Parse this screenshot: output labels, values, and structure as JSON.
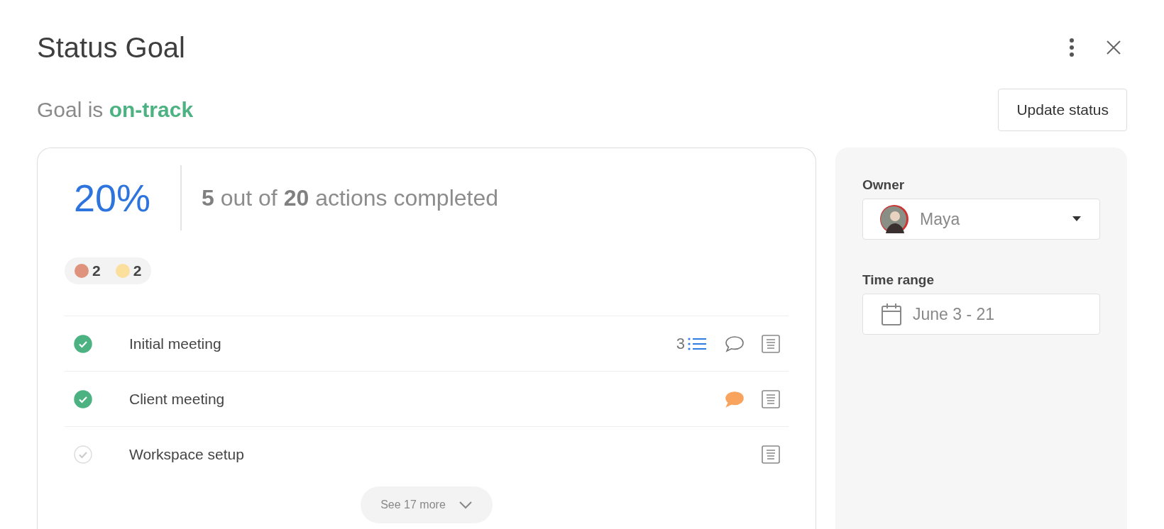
{
  "dialog": {
    "title": "Status Goal"
  },
  "status": {
    "prefix": "Goal is",
    "value": "on-track",
    "color": "#4db282"
  },
  "update_button": "Update status",
  "progress": {
    "percent": "20%",
    "summary": "**5** out of **20** actions completed"
  },
  "flags": [
    {
      "color": "#e0937c",
      "count": "2"
    },
    {
      "color": "#fbdf9c",
      "count": "2"
    }
  ],
  "actions": [
    {
      "title": "Initial meeting",
      "done": true,
      "subtasks": "3",
      "has_comment": true,
      "comment_unread": false
    },
    {
      "title": "Client meeting",
      "done": true,
      "has_comment": true,
      "comment_unread": true
    },
    {
      "title": "Workspace setup",
      "done": false,
      "has_comment": false
    }
  ],
  "see_more": "See 17 more",
  "sidebar": {
    "owner_label": "Owner",
    "owner": "Maya",
    "time_label": "Time range",
    "time_range": "June 3 - 21"
  }
}
